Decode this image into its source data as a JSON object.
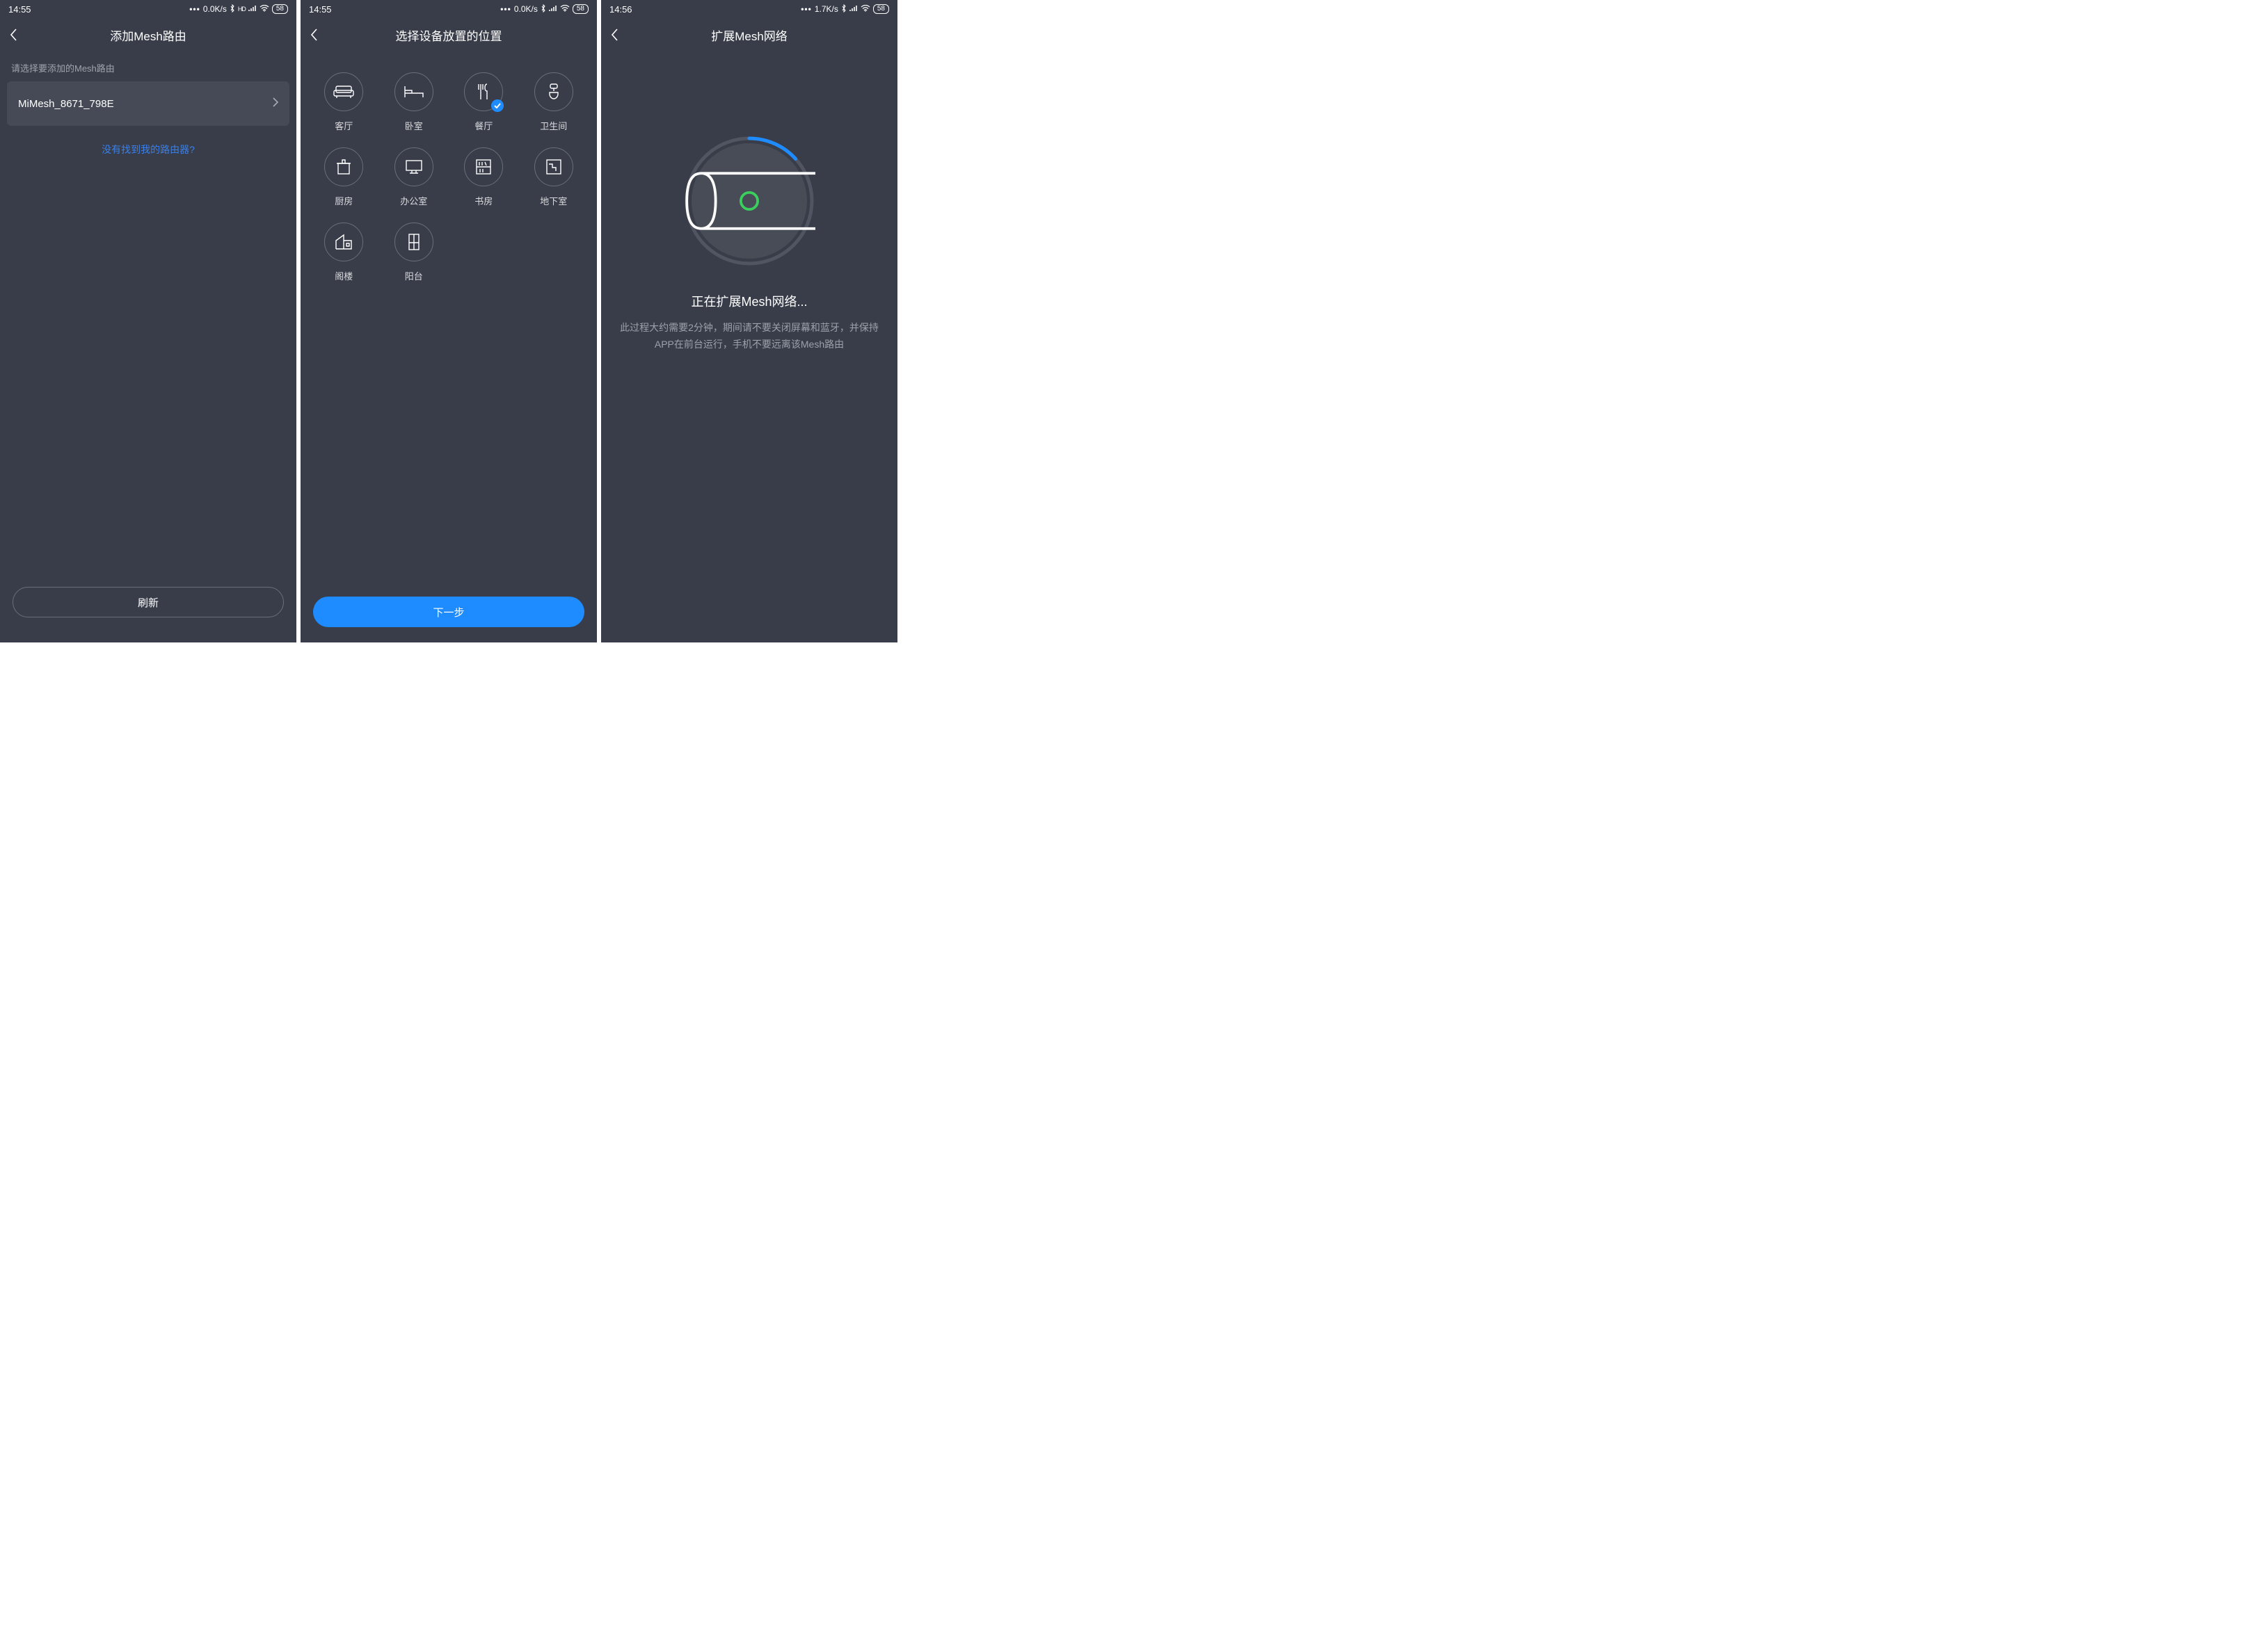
{
  "screen1": {
    "status": {
      "time": "14:55",
      "net": "0.0K/s",
      "battery": "58"
    },
    "title": "添加Mesh路由",
    "hint": "请选择要添加的Mesh路由",
    "router_name": "MiMesh_8671_798E",
    "not_found": "没有找到我的路由器?",
    "refresh": "刷新"
  },
  "screen2": {
    "status": {
      "time": "14:55",
      "net": "0.0K/s",
      "battery": "58"
    },
    "title": "选择设备放置的位置",
    "locations": [
      "客厅",
      "卧室",
      "餐厅",
      "卫生间",
      "厨房",
      "办公室",
      "书房",
      "地下室",
      "阁楼",
      "阳台"
    ],
    "selected_index": 2,
    "next": "下一步"
  },
  "screen3": {
    "status": {
      "time": "14:56",
      "net": "1.7K/s",
      "battery": "58"
    },
    "title": "扩展Mesh网络",
    "status_title": "正在扩展Mesh网络...",
    "status_desc": "此过程大约需要2分钟，期间请不要关闭屏幕和蓝牙，并保持APP在前台运行，手机不要远离该Mesh路由"
  }
}
